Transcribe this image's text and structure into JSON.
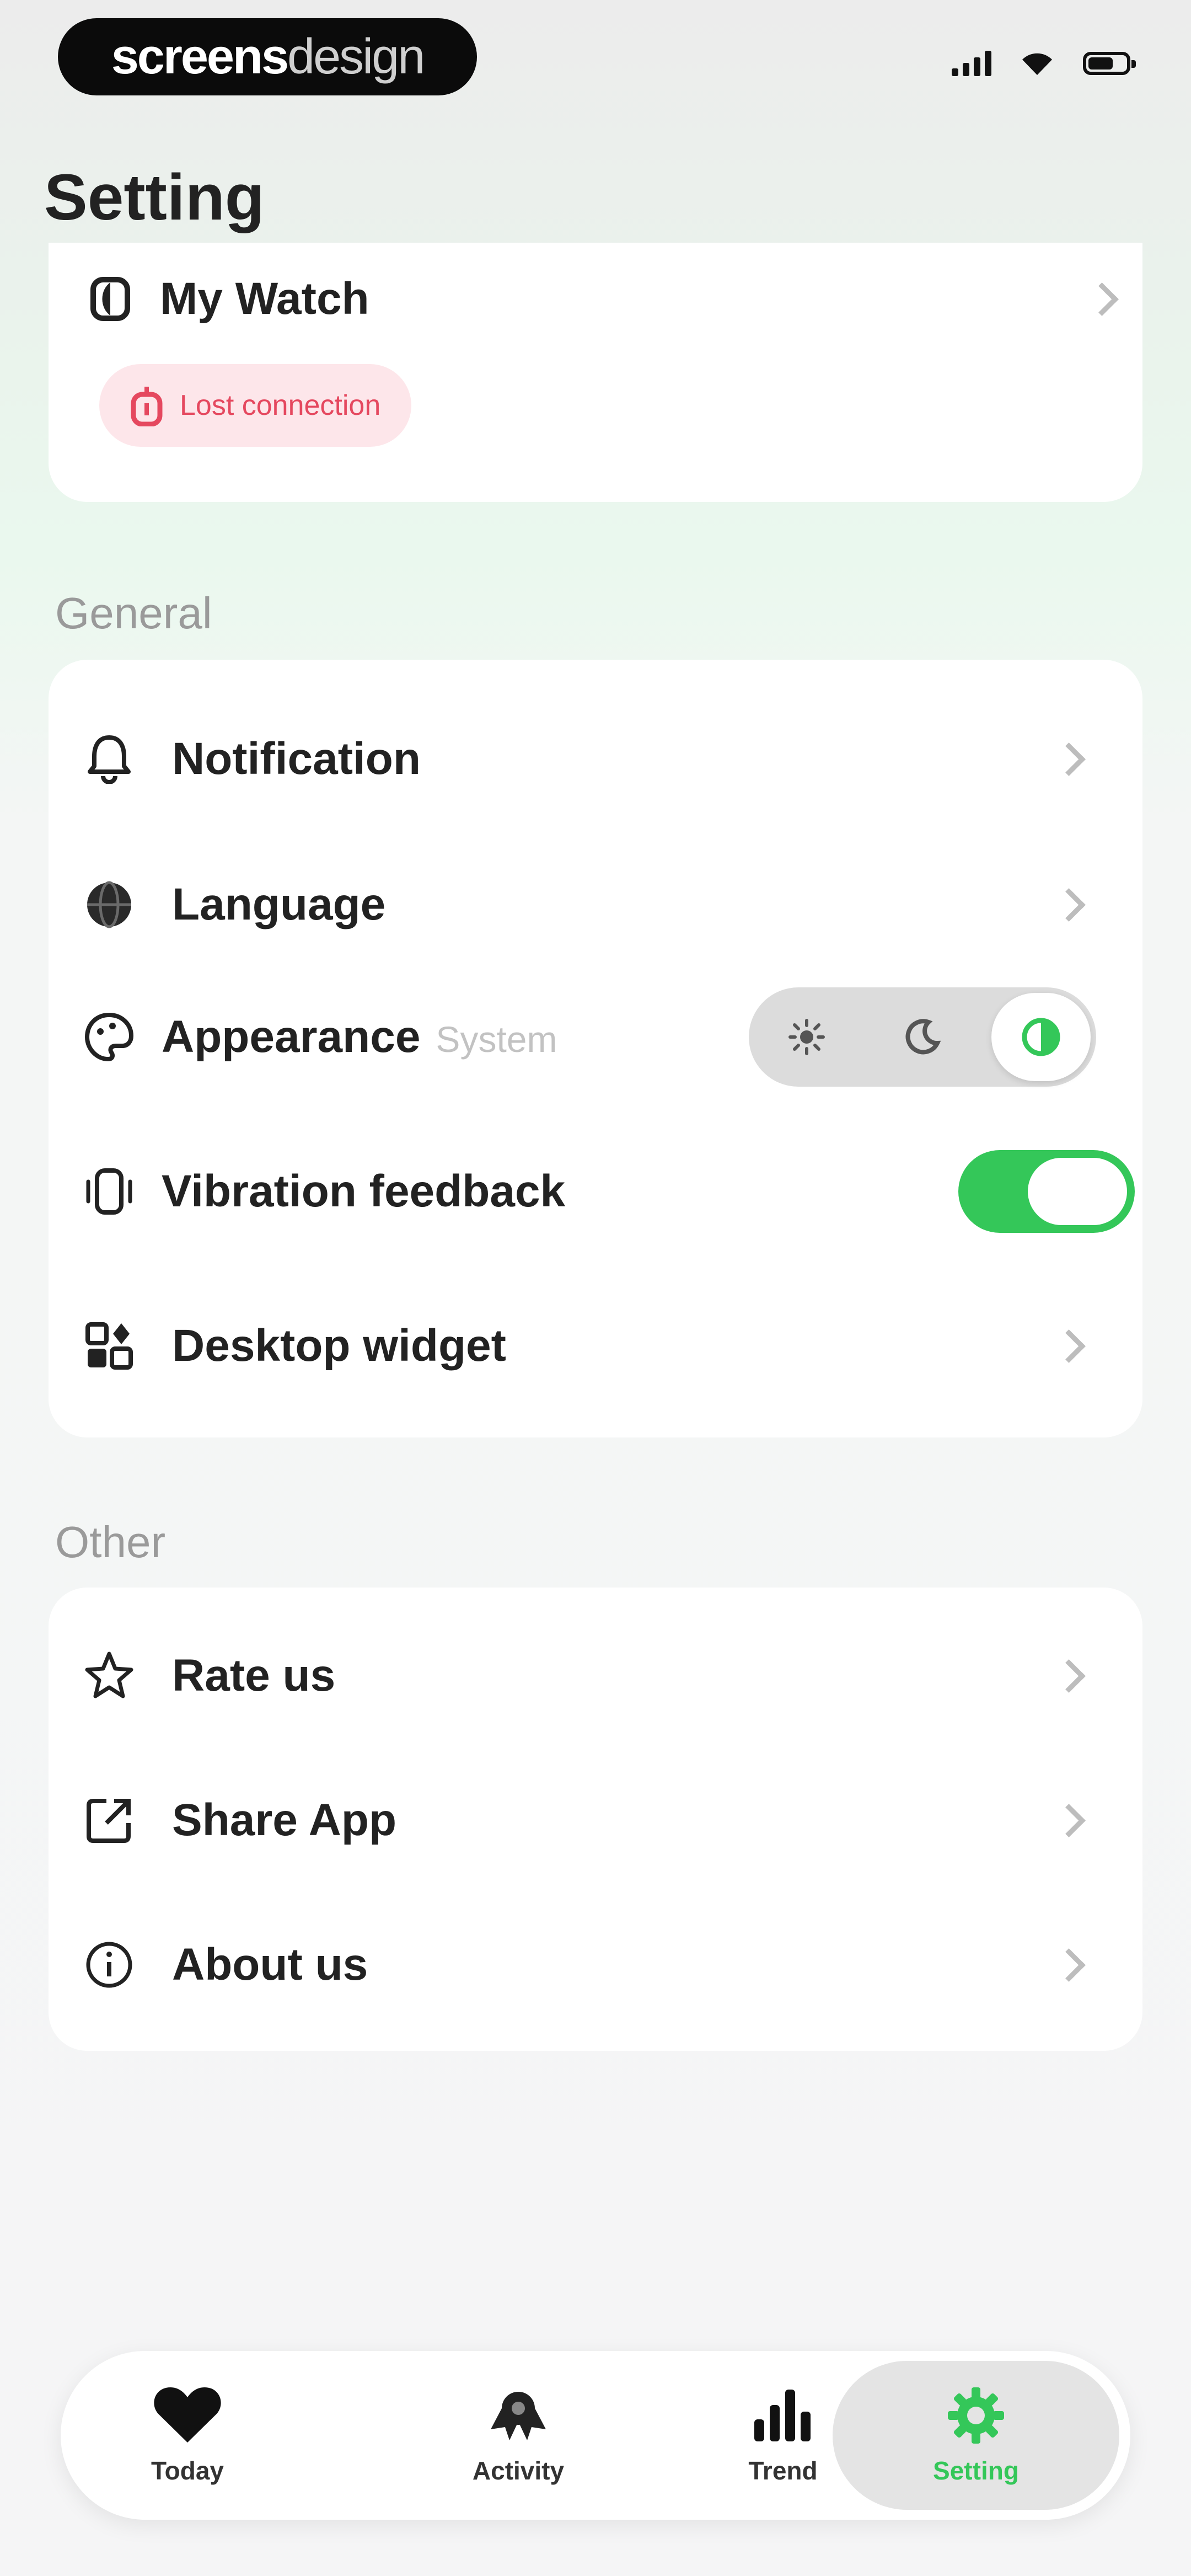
{
  "status_bar": {
    "brand_bold": "screens",
    "brand_light": "design"
  },
  "page": {
    "title": "Setting"
  },
  "watch": {
    "label": "My Watch",
    "status": "Lost connection"
  },
  "general": {
    "section_label": "General",
    "items": [
      {
        "label": "Notification",
        "icon": "bell-icon"
      },
      {
        "label": "Language",
        "icon": "globe-icon"
      },
      {
        "label": "Appearance",
        "icon": "palette-icon",
        "value": "System",
        "options": [
          "sun-icon",
          "moon-icon",
          "half-circle-icon"
        ],
        "selected": 2
      },
      {
        "label": "Vibration feedback",
        "icon": "vibration-icon",
        "toggle": true
      },
      {
        "label": "Desktop widget",
        "icon": "widget-icon"
      }
    ]
  },
  "other": {
    "section_label": "Other",
    "items": [
      {
        "label": "Rate us",
        "icon": "star-icon"
      },
      {
        "label": "Share App",
        "icon": "share-icon"
      },
      {
        "label": "About us",
        "icon": "info-icon"
      }
    ]
  },
  "tabbar": {
    "tabs": [
      {
        "label": "Today",
        "icon": "heart-icon"
      },
      {
        "label": "Activity",
        "icon": "activity-icon"
      },
      {
        "label": "Trend",
        "icon": "bar-chart-icon"
      },
      {
        "label": "Setting",
        "icon": "gear-icon"
      }
    ],
    "active_index": 3
  },
  "colors": {
    "accent": "#34c759",
    "danger": "#e5485f"
  }
}
